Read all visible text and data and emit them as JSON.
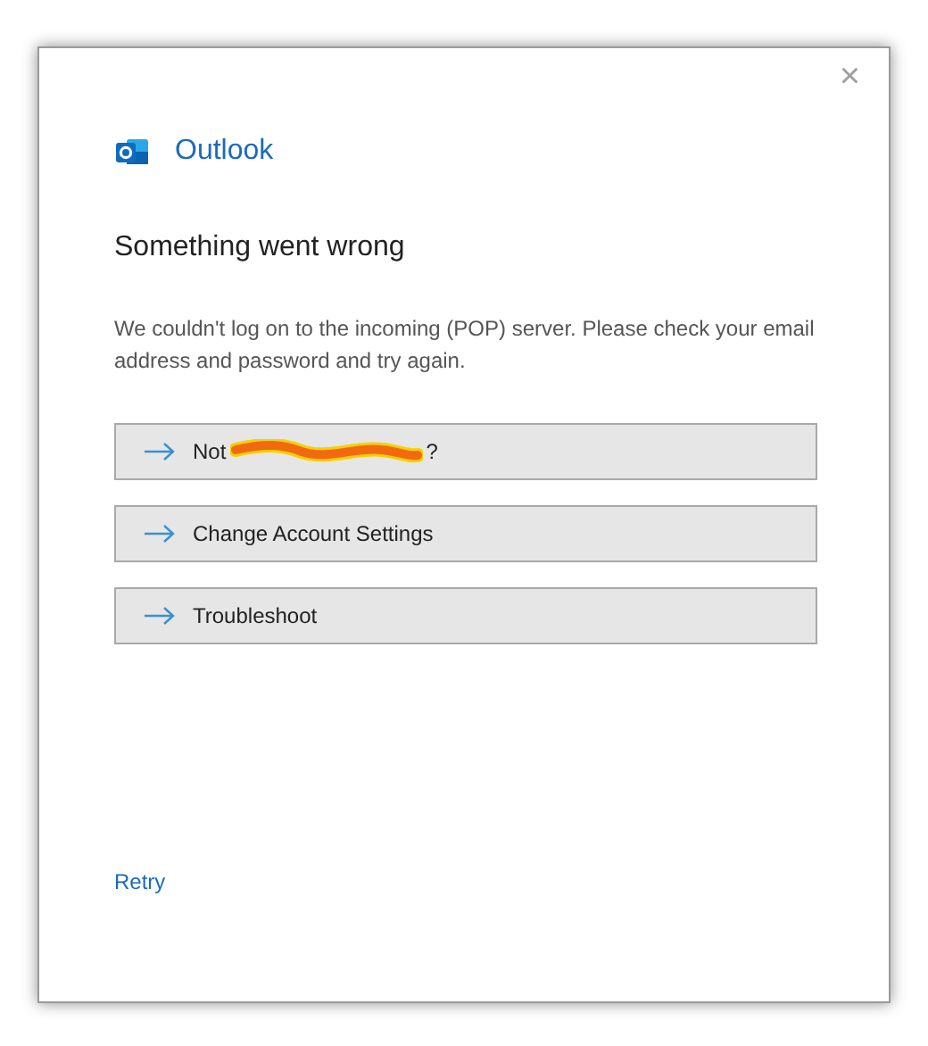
{
  "window": {
    "close": "×"
  },
  "app": {
    "name": "Outlook"
  },
  "heading": "Something went wrong",
  "message": "We couldn't log on to the incoming (POP) server. Please check your email address and password and try again.",
  "options": [
    {
      "kind": "redacted",
      "label_before": "Not",
      "label_after": "?"
    },
    {
      "kind": "plain",
      "label": "Change Account Settings"
    },
    {
      "kind": "plain",
      "label": "Troubleshoot"
    }
  ],
  "retry": "Retry"
}
